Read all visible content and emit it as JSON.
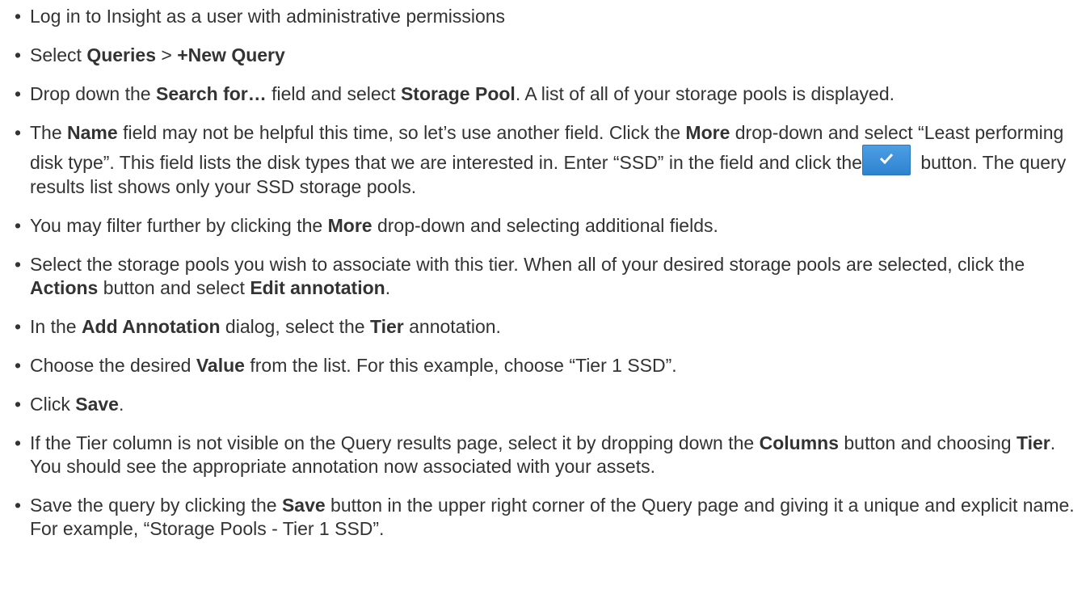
{
  "steps": {
    "s1": {
      "text": "Log in to Insight as a user with administrative permissions"
    },
    "s2": {
      "a": "Select ",
      "b1": "Queries",
      "c": " > ",
      "b2": "+New Query"
    },
    "s3": {
      "a": "Drop down the ",
      "b1": "Search for…",
      "c": " field and select ",
      "b2": "Storage Pool",
      "d": ". A list of all of your storage pools is displayed."
    },
    "s4": {
      "a": "The ",
      "b1": "Name",
      "c": " field may not be helpful this time, so let’s use another field. Click the ",
      "b2": "More",
      "d": " drop-down and select “Least performing disk type”. This field lists the disk types that we are interested in. Enter “SSD” in the field and click the",
      "e": " button. The query results list shows only your SSD storage pools.",
      "button_icon": "check-icon"
    },
    "s5": {
      "a": "You may filter further by clicking the ",
      "b1": "More",
      "c": " drop-down and selecting additional fields."
    },
    "s6": {
      "a": "Select the storage pools you wish to associate with this tier. When all of your desired storage pools are selected, click the ",
      "b1": "Actions",
      "c": " button and select ",
      "b2": "Edit annotation",
      "d": "."
    },
    "s7": {
      "a": "In the ",
      "b1": "Add Annotation",
      "c": " dialog, select the ",
      "b2": "Tier",
      "d": " annotation."
    },
    "s8": {
      "a": "Choose the desired ",
      "b1": "Value",
      "c": " from the list. For this example, choose “Tier 1 SSD”."
    },
    "s9": {
      "a": "Click ",
      "b1": "Save",
      "c": "."
    },
    "s10": {
      "a": "If the Tier column is not visible on the Query results page, select it by dropping down the ",
      "b1": "Columns",
      "c": " button and choosing ",
      "b2": "Tier",
      "d": ". You should see the appropriate annotation now associated with your assets."
    },
    "s11": {
      "a": "Save the query by clicking the ",
      "b1": "Save",
      "c": " button in the upper right corner of the Query page and giving it a unique and explicit name. For example, “Storage Pools - Tier 1 SSD”."
    }
  },
  "colors": {
    "text": "#333333",
    "button": "#3a8fdc"
  }
}
